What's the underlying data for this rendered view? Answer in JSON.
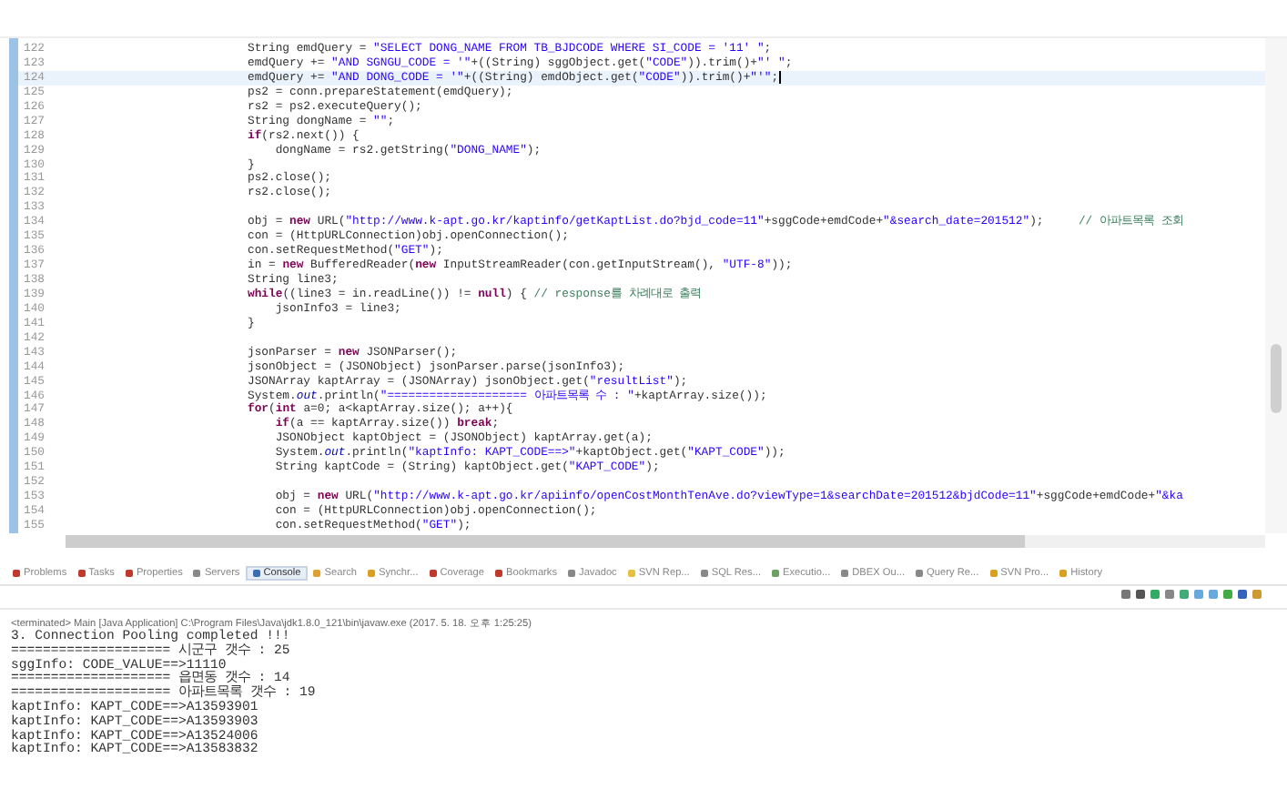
{
  "editor": {
    "lines": [
      {
        "number": "122",
        "current": false,
        "tokens": [
          {
            "text": "String emdQuery = ",
            "kind": "plain"
          },
          {
            "text": "\"SELECT DONG_NAME FROM TB_BJDCODE WHERE SI_CODE = '11' \"",
            "kind": "string"
          },
          {
            "text": ";",
            "kind": "plain"
          }
        ]
      },
      {
        "number": "123",
        "current": false,
        "tokens": [
          {
            "text": "emdQuery += ",
            "kind": "plain"
          },
          {
            "text": "\"AND SGNGU_CODE = '\"",
            "kind": "string"
          },
          {
            "text": "+((String) sggObject.get(",
            "kind": "plain"
          },
          {
            "text": "\"CODE\"",
            "kind": "string"
          },
          {
            "text": ")).trim()+",
            "kind": "plain"
          },
          {
            "text": "\"' \"",
            "kind": "string"
          },
          {
            "text": ";",
            "kind": "plain"
          }
        ]
      },
      {
        "number": "124",
        "current": true,
        "tokens": [
          {
            "text": "emdQuery += ",
            "kind": "plain"
          },
          {
            "text": "\"AND DONG_CODE = '\"",
            "kind": "string"
          },
          {
            "text": "+((String) emdObject.get(",
            "kind": "plain"
          },
          {
            "text": "\"CODE\"",
            "kind": "string"
          },
          {
            "text": ")).trim()+",
            "kind": "plain"
          },
          {
            "text": "\"'\"",
            "kind": "string"
          },
          {
            "text": ";",
            "kind": "plain"
          }
        ]
      },
      {
        "number": "125",
        "current": false,
        "tokens": [
          {
            "text": "ps2 = conn.prepareStatement(emdQuery);",
            "kind": "plain"
          }
        ]
      },
      {
        "number": "126",
        "current": false,
        "tokens": [
          {
            "text": "rs2 = ps2.executeQuery();",
            "kind": "plain"
          }
        ]
      },
      {
        "number": "127",
        "current": false,
        "tokens": [
          {
            "text": "String dongName = ",
            "kind": "plain"
          },
          {
            "text": "\"\"",
            "kind": "string"
          },
          {
            "text": ";",
            "kind": "plain"
          }
        ]
      },
      {
        "number": "128",
        "current": false,
        "tokens": [
          {
            "text": "if",
            "kind": "keyword"
          },
          {
            "text": "(rs2.next()) {",
            "kind": "plain"
          }
        ]
      },
      {
        "number": "129",
        "current": false,
        "tokens": [
          {
            "text": "    dongName = rs2.getString(",
            "kind": "plain"
          },
          {
            "text": "\"DONG_NAME\"",
            "kind": "string"
          },
          {
            "text": ");",
            "kind": "plain"
          }
        ]
      },
      {
        "number": "130",
        "current": false,
        "tokens": [
          {
            "text": "}",
            "kind": "plain"
          }
        ]
      },
      {
        "number": "131",
        "current": false,
        "tokens": [
          {
            "text": "ps2.close();",
            "kind": "plain"
          }
        ]
      },
      {
        "number": "132",
        "current": false,
        "tokens": [
          {
            "text": "rs2.close();",
            "kind": "plain"
          }
        ]
      },
      {
        "number": "133",
        "current": false
      },
      {
        "number": "134",
        "current": false,
        "tokens": [
          {
            "text": "obj = ",
            "kind": "plain"
          },
          {
            "text": "new",
            "kind": "keyword"
          },
          {
            "text": " URL(",
            "kind": "plain"
          },
          {
            "text": "\"http://www.k-apt.go.kr/kaptinfo/getKaptList.do?bjd_code=11\"",
            "kind": "string"
          },
          {
            "text": "+sggCode+emdCode+",
            "kind": "plain"
          },
          {
            "text": "\"&search_date=201512\"",
            "kind": "string"
          },
          {
            "text": ");     ",
            "kind": "plain"
          },
          {
            "text": "// 아파트목록 조회",
            "kind": "comment"
          }
        ]
      },
      {
        "number": "135",
        "current": false,
        "tokens": [
          {
            "text": "con = (HttpURLConnection)obj.openConnection();",
            "kind": "plain"
          }
        ]
      },
      {
        "number": "136",
        "current": false,
        "tokens": [
          {
            "text": "con.setRequestMethod(",
            "kind": "plain"
          },
          {
            "text": "\"GET\"",
            "kind": "string"
          },
          {
            "text": ");",
            "kind": "plain"
          }
        ]
      },
      {
        "number": "137",
        "current": false,
        "tokens": [
          {
            "text": "in = ",
            "kind": "plain"
          },
          {
            "text": "new",
            "kind": "keyword"
          },
          {
            "text": " BufferedReader(",
            "kind": "plain"
          },
          {
            "text": "new",
            "kind": "keyword"
          },
          {
            "text": " InputStreamReader(con.getInputStream(), ",
            "kind": "plain"
          },
          {
            "text": "\"UTF-8\"",
            "kind": "string"
          },
          {
            "text": "));",
            "kind": "plain"
          }
        ]
      },
      {
        "number": "138",
        "current": false,
        "tokens": [
          {
            "text": "String line3;",
            "kind": "plain"
          }
        ]
      },
      {
        "number": "139",
        "current": false,
        "tokens": [
          {
            "text": "while",
            "kind": "keyword"
          },
          {
            "text": "((line3 = in.readLine()) != ",
            "kind": "plain"
          },
          {
            "text": "null",
            "kind": "keyword"
          },
          {
            "text": ") { ",
            "kind": "plain"
          },
          {
            "text": "// response를 차례대로 출력",
            "kind": "comment"
          }
        ]
      },
      {
        "number": "140",
        "current": false,
        "tokens": [
          {
            "text": "    jsonInfo3 = line3;",
            "kind": "plain"
          }
        ]
      },
      {
        "number": "141",
        "current": false,
        "tokens": [
          {
            "text": "}",
            "kind": "plain"
          }
        ]
      },
      {
        "number": "142",
        "current": false
      },
      {
        "number": "143",
        "current": false,
        "tokens": [
          {
            "text": "jsonParser = ",
            "kind": "plain"
          },
          {
            "text": "new",
            "kind": "keyword"
          },
          {
            "text": " JSONParser();",
            "kind": "plain"
          }
        ]
      },
      {
        "number": "144",
        "current": false,
        "tokens": [
          {
            "text": "jsonObject = (JSONObject) jsonParser.parse(jsonInfo3);",
            "kind": "plain"
          }
        ]
      },
      {
        "number": "145",
        "current": false,
        "tokens": [
          {
            "text": "JSONArray kaptArray = (JSONArray) jsonObject.get(",
            "kind": "plain"
          },
          {
            "text": "\"resultList\"",
            "kind": "string"
          },
          {
            "text": ");",
            "kind": "plain"
          }
        ]
      },
      {
        "number": "146",
        "current": false,
        "tokens": [
          {
            "text": "System.",
            "kind": "plain"
          },
          {
            "text": "out",
            "kind": "field"
          },
          {
            "text": ".println(",
            "kind": "plain"
          },
          {
            "text": "\"==================== 아파트목록 수 : \"",
            "kind": "string"
          },
          {
            "text": "+kaptArray.size());",
            "kind": "plain"
          }
        ]
      },
      {
        "number": "147",
        "current": false,
        "tokens": [
          {
            "text": "for",
            "kind": "keyword"
          },
          {
            "text": "(",
            "kind": "plain"
          },
          {
            "text": "int",
            "kind": "keyword"
          },
          {
            "text": " a=0; a<kaptArray.size(); a++){",
            "kind": "plain"
          }
        ]
      },
      {
        "number": "148",
        "current": false,
        "tokens": [
          {
            "text": "    if",
            "kind": "keyword"
          },
          {
            "text": "(a == kaptArray.size()) ",
            "kind": "plain"
          },
          {
            "text": "break",
            "kind": "keyword"
          },
          {
            "text": ";",
            "kind": "plain"
          }
        ]
      },
      {
        "number": "149",
        "current": false,
        "tokens": [
          {
            "text": "    JSONObject kaptObject = (JSONObject) kaptArray.get(a);",
            "kind": "plain"
          }
        ]
      },
      {
        "number": "150",
        "current": false,
        "tokens": [
          {
            "text": "    System.",
            "kind": "plain"
          },
          {
            "text": "out",
            "kind": "field"
          },
          {
            "text": ".println(",
            "kind": "plain"
          },
          {
            "text": "\"kaptInfo: KAPT_CODE==>\"",
            "kind": "string"
          },
          {
            "text": "+kaptObject.get(",
            "kind": "plain"
          },
          {
            "text": "\"KAPT_CODE\"",
            "kind": "string"
          },
          {
            "text": "));",
            "kind": "plain"
          }
        ]
      },
      {
        "number": "151",
        "current": false,
        "tokens": [
          {
            "text": "    String kaptCode = (String) kaptObject.get(",
            "kind": "plain"
          },
          {
            "text": "\"KAPT_CODE\"",
            "kind": "string"
          },
          {
            "text": ");",
            "kind": "plain"
          }
        ]
      },
      {
        "number": "152",
        "current": false
      },
      {
        "number": "153",
        "current": false,
        "tokens": [
          {
            "text": "    obj = ",
            "kind": "plain"
          },
          {
            "text": "new",
            "kind": "keyword"
          },
          {
            "text": " URL(",
            "kind": "plain"
          },
          {
            "text": "\"http://www.k-apt.go.kr/apiinfo/openCostMonthTenAve.do?viewType=1&searchDate=201512&bjdCode=11\"",
            "kind": "string"
          },
          {
            "text": "+sggCode+emdCode+",
            "kind": "plain"
          },
          {
            "text": "\"&ka",
            "kind": "string"
          }
        ]
      },
      {
        "number": "154",
        "current": false,
        "tokens": [
          {
            "text": "    con = (HttpURLConnection)obj.openConnection();",
            "kind": "plain"
          }
        ]
      },
      {
        "number": "155",
        "current": false,
        "tokens": [
          {
            "text": "    con.setRequestMethod(",
            "kind": "plain"
          },
          {
            "text": "\"GET\"",
            "kind": "string"
          },
          {
            "text": ");",
            "kind": "plain"
          }
        ]
      }
    ]
  },
  "views": {
    "tabs": [
      {
        "label": "Problems",
        "selected": false,
        "color": "#c0392b"
      },
      {
        "label": "Tasks",
        "selected": false,
        "color": "#c0392b"
      },
      {
        "label": "Properties",
        "selected": false,
        "color": "#c0392b"
      },
      {
        "label": "Servers",
        "selected": false,
        "color": "#888888"
      },
      {
        "label": "Console",
        "selected": true,
        "color": "#3b6db3"
      },
      {
        "label": "Search",
        "selected": false,
        "color": "#e0a030"
      },
      {
        "label": "Synchr...",
        "selected": false,
        "color": "#d9a020"
      },
      {
        "label": "Coverage",
        "selected": false,
        "color": "#c0392b"
      },
      {
        "label": "Bookmarks",
        "selected": false,
        "color": "#c0392b"
      },
      {
        "label": "Javadoc",
        "selected": false,
        "color": "#888888"
      },
      {
        "label": "SVN Rep...",
        "selected": false,
        "color": "#e8c040"
      },
      {
        "label": "SQL Res...",
        "selected": false,
        "color": "#888888"
      },
      {
        "label": "Executio...",
        "selected": false,
        "color": "#6aa060"
      },
      {
        "label": "DBEX Ou...",
        "selected": false,
        "color": "#888888"
      },
      {
        "label": "Query Re...",
        "selected": false,
        "color": "#888888"
      },
      {
        "label": "SVN Pro...",
        "selected": false,
        "color": "#d9a020"
      },
      {
        "label": "History",
        "selected": false,
        "color": "#d9a020"
      }
    ]
  },
  "console": {
    "header": "<terminated> Main [Java Application] C:\\Program Files\\Java\\jdk1.8.0_121\\bin\\javaw.exe (2017. 5. 18. 오후 1:25:25)",
    "lines": [
      "3. Connection Pooling completed !!!",
      "==================== 시군구 갯수 : 25",
      "sggInfo: CODE_VALUE==>11110",
      "==================== 읍면동 갯수 : 14",
      "==================== 아파트목록 갯수 : 19",
      "kaptInfo: KAPT_CODE==>A13593901",
      "kaptInfo: KAPT_CODE==>A13593903",
      "kaptInfo: KAPT_CODE==>A13524006",
      "kaptInfo: KAPT_CODE==>A13583832"
    ]
  }
}
